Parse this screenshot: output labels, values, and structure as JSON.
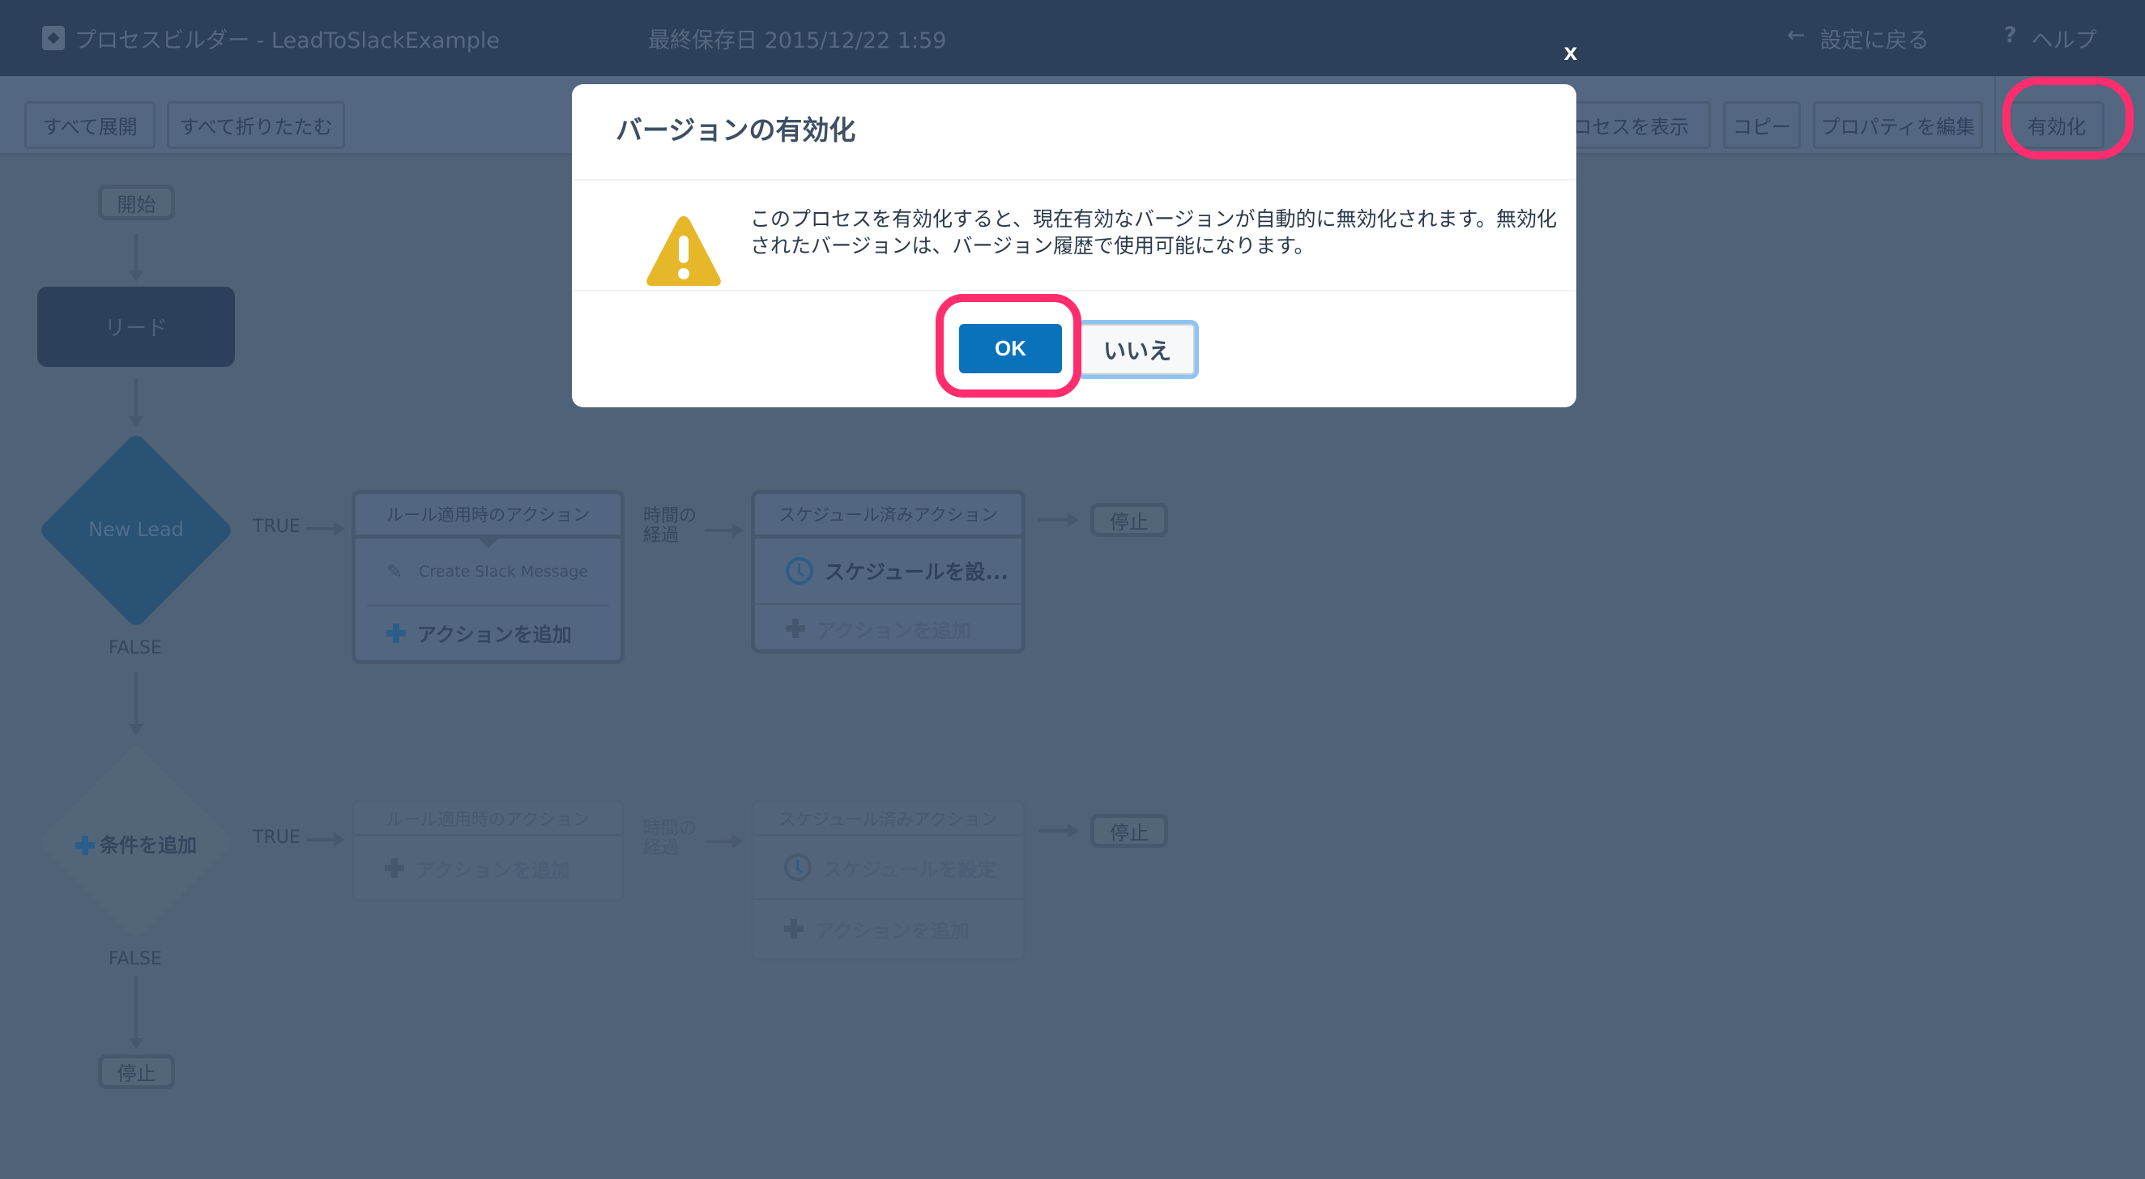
{
  "header": {
    "app_title": "プロセスビルダー - LeadToSlackExample",
    "last_saved": "最終保存日 2015/12/22 1:59",
    "back_to_setup": "設定に戻る",
    "back_arrow": "←",
    "help": "ヘルプ",
    "help_icon": "?"
  },
  "toolbar": {
    "expand_all": "すべて展開",
    "collapse_all": "すべて折りたたむ",
    "view_process": "プロセスを表示",
    "copy": "コピー",
    "edit_properties": "プロパティを編集",
    "activate": "有効化"
  },
  "flow": {
    "start": "開始",
    "object": "リード",
    "criteria": [
      {
        "name": "New Lead",
        "true_label": "TRUE",
        "false_label": "FALSE",
        "immediate_header": "ルール適用時のアクション",
        "immediate_actions": [
          "Create Slack Message"
        ],
        "add_action": "アクションを追加",
        "time_label_1": "時間の",
        "time_label_2": "経過",
        "scheduled_header": "スケジュール済みアクション",
        "scheduled_set": "スケジュールを設...",
        "scheduled_add_action": "アクションを追加",
        "stop": "停止"
      },
      {
        "name": "条件を追加",
        "true_label": "TRUE",
        "false_label": "FALSE",
        "immediate_header": "ルール適用時のアクション",
        "add_action": "アクションを追加",
        "time_label_1": "時間の",
        "time_label_2": "経過",
        "scheduled_header": "スケジュール済みアクション",
        "scheduled_set": "スケジュールを設定",
        "scheduled_add_action": "アクションを追加",
        "stop": "停止"
      }
    ],
    "end": "停止"
  },
  "modal": {
    "close": "x",
    "title": "バージョンの有効化",
    "message": "このプロセスを有効化すると、現在有効なバージョンが自動的に無効化されます。無効化されたバージョンは、バージョン履歴で使用可能になります。",
    "ok": "OK",
    "no": "いいえ"
  },
  "colors": {
    "header_bg": "#2c4159",
    "ok_button": "#0a72bb",
    "highlight": "#ff2d6e",
    "warning": "#e6b729"
  }
}
